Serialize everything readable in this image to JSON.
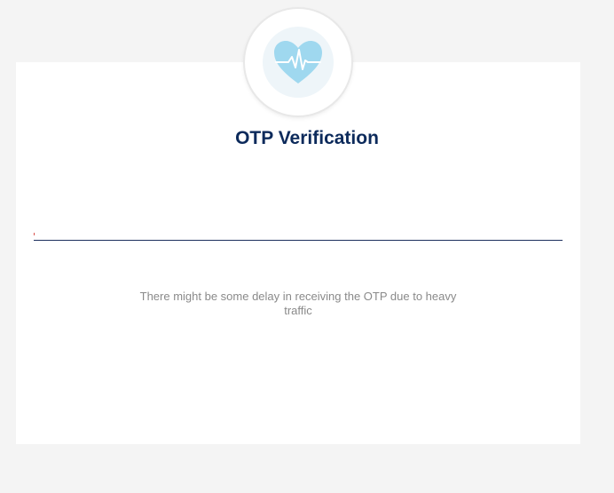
{
  "title": "OTP Verification",
  "logo": {
    "icon": "heart-pulse-icon",
    "heart_color": "#9fd8ef",
    "pulse_color": "#ffffff"
  },
  "otp_input": {
    "value": "",
    "placeholder": ""
  },
  "notice": "There might be some delay in receiving the OTP due to heavy traffic",
  "colors": {
    "title": "#0c2a5b",
    "underline": "#1c2f5e",
    "notice": "#8a8a8a",
    "background": "#f4f4f4",
    "card": "#ffffff"
  }
}
